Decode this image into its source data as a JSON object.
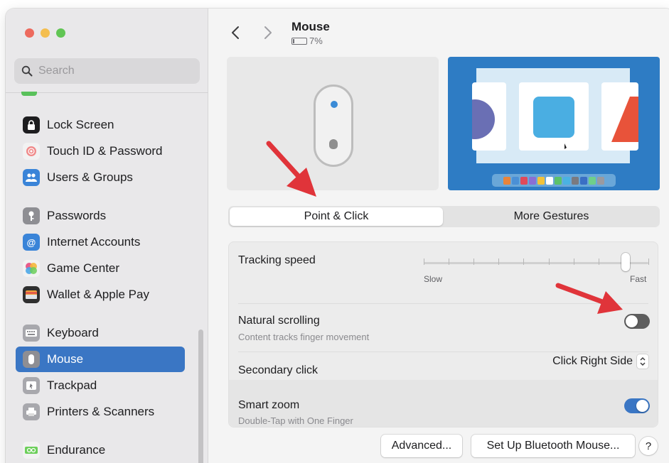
{
  "window": {
    "title": "Mouse",
    "battery": "7%"
  },
  "search": {
    "placeholder": "Search"
  },
  "sidebar": {
    "items": [
      {
        "label": "Lock Screen",
        "icon": "lock-icon",
        "color": "#1d1d1f"
      },
      {
        "label": "Touch ID & Password",
        "icon": "fingerprint-icon",
        "color": "#f2f2f2"
      },
      {
        "label": "Users & Groups",
        "icon": "users-icon",
        "color": "#3a84d8"
      },
      {
        "label": "Passwords",
        "icon": "key-icon",
        "color": "#8e8e93"
      },
      {
        "label": "Internet Accounts",
        "icon": "at-icon",
        "color": "#3a84d8"
      },
      {
        "label": "Game Center",
        "icon": "game-center-icon",
        "color": "#f2f2f2"
      },
      {
        "label": "Wallet & Apple Pay",
        "icon": "wallet-icon",
        "color": "#2f2f2f"
      },
      {
        "label": "Keyboard",
        "icon": "keyboard-icon",
        "color": "#a8a8ad"
      },
      {
        "label": "Mouse",
        "icon": "mouse-icon",
        "color": "#8e8e93",
        "active": true
      },
      {
        "label": "Trackpad",
        "icon": "trackpad-icon",
        "color": "#a8a8ad"
      },
      {
        "label": "Printers & Scanners",
        "icon": "printer-icon",
        "color": "#a8a8ad"
      },
      {
        "label": "Endurance",
        "icon": "endurance-icon",
        "color": "#f2f2f2"
      }
    ]
  },
  "tabs": {
    "point_click": "Point & Click",
    "more_gestures": "More Gestures",
    "selected": "Point & Click"
  },
  "settings": {
    "tracking_speed": {
      "label": "Tracking speed",
      "min_label": "Slow",
      "max_label": "Fast",
      "value_fraction": 0.9,
      "ticks": 10
    },
    "natural_scrolling": {
      "label": "Natural scrolling",
      "description": "Content tracks finger movement",
      "enabled": false
    },
    "secondary_click": {
      "label": "Secondary click",
      "value": "Click Right Side"
    },
    "smart_zoom": {
      "label": "Smart zoom",
      "description": "Double-Tap with One Finger",
      "enabled": true
    }
  },
  "buttons": {
    "advanced": "Advanced...",
    "bluetooth": "Set Up Bluetooth Mouse...",
    "help": "?"
  },
  "colors": {
    "accent": "#3a76c4",
    "annotation_arrow": "#e0343a"
  }
}
